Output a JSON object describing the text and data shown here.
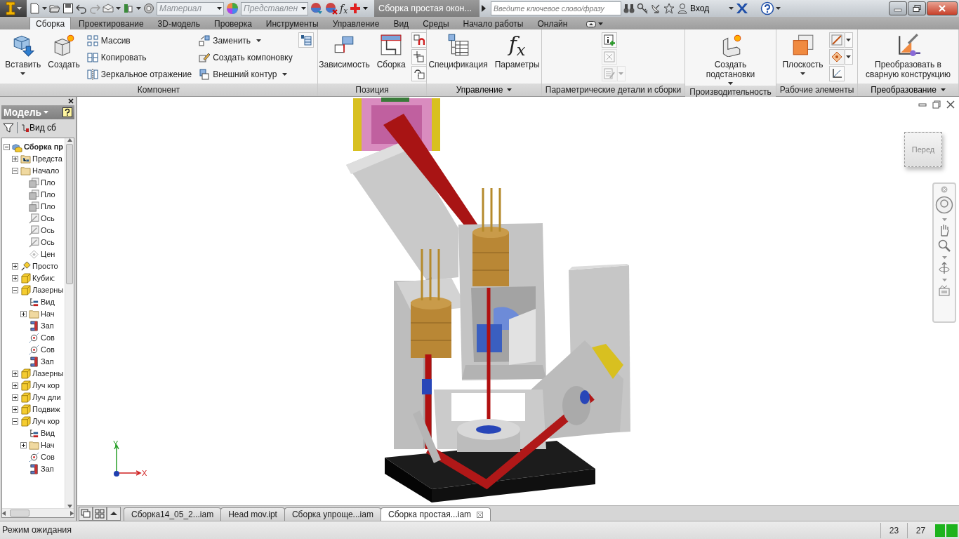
{
  "title_bar": {
    "material": "Материал",
    "appearance": "Представлен",
    "symbol": "f$_{x}$",
    "document_title": "Сборка простая окон...",
    "search": {
      "placeholder": "Введите ключевое слово/фразу"
    },
    "sign_in": "Вход"
  },
  "tabs": [
    {
      "label": "Сборка",
      "selected": true
    },
    {
      "label": "Проектирование",
      "selected": false
    },
    {
      "label": "3D-модель",
      "selected": false
    },
    {
      "label": "Проверка",
      "selected": false
    },
    {
      "label": "Инструменты",
      "selected": false
    },
    {
      "label": "Управление",
      "selected": false
    },
    {
      "label": "Вид",
      "selected": false
    },
    {
      "label": "Среды",
      "selected": false
    },
    {
      "label": "Начало работы",
      "selected": false
    },
    {
      "label": "Онлайн",
      "selected": false
    }
  ],
  "ribbon": [
    {
      "label": "Компонент",
      "menu": false,
      "groups": [
        {
          "kind": "large",
          "label": "Вставить",
          "dropdown": true
        },
        {
          "kind": "large",
          "label": "Создать",
          "dropdown": false
        },
        {
          "kind": "list",
          "items": [
            {
              "label": "Массив",
              "dropdown": false
            },
            {
              "label": "Копировать",
              "dropdown": false
            },
            {
              "label": "Зеркальное отражение",
              "dropdown": false
            }
          ]
        },
        {
          "kind": "list",
          "items": [
            {
              "label": "Заменить",
              "dropdown": true
            },
            {
              "label": "Создать компоновку",
              "dropdown": false
            },
            {
              "label": "Внешний контур",
              "dropdown": true
            }
          ]
        },
        {
          "kind": "icons",
          "items": [
            {
              "dropdown": false,
              "disabled": false
            }
          ]
        }
      ]
    },
    {
      "label": "Позиция",
      "menu": false,
      "groups": [
        {
          "kind": "large",
          "label": "Зависимость",
          "dropdown": false
        },
        {
          "kind": "large",
          "label": "Сборка",
          "dropdown": false
        },
        {
          "kind": "icons",
          "items": [
            {
              "dropdown": false,
              "disabled": false
            },
            {
              "dropdown": false,
              "disabled": false
            },
            {
              "dropdown": false,
              "disabled": false
            }
          ]
        }
      ]
    },
    {
      "label": "Управление",
      "menu": true,
      "groups": [
        {
          "kind": "large",
          "label": "Спецификация",
          "dropdown": false
        },
        {
          "kind": "large",
          "label": "Параметры",
          "symbol": "f$_{x}$",
          "dropdown": false
        }
      ]
    },
    {
      "label": "Параметрические детали и сборки",
      "menu": false,
      "groups": [
        {
          "kind": "icons",
          "items": [
            {
              "dropdown": false,
              "disabled": false
            },
            {
              "dropdown": false,
              "disabled": true
            },
            {
              "dropdown": true,
              "disabled": true
            }
          ]
        }
      ]
    },
    {
      "label": "Производительность",
      "menu": false,
      "groups": [
        {
          "kind": "large",
          "label": "Создать подстановки",
          "dropdown": true
        }
      ]
    },
    {
      "label": "Рабочие элементы",
      "menu": false,
      "groups": [
        {
          "kind": "large",
          "label": "Плоскость",
          "dropdown": true
        },
        {
          "kind": "icons",
          "items": [
            {
              "dropdown": true,
              "disabled": false
            },
            {
              "dropdown": true,
              "disabled": false
            },
            {
              "dropdown": false,
              "disabled": false
            }
          ]
        }
      ]
    },
    {
      "label": "Преобразование",
      "menu": true,
      "groups": [
        {
          "kind": "large",
          "label": "Преобразовать в сварную конструкцию",
          "dropdown": false
        }
      ]
    }
  ],
  "browser": {
    "title": "Модель",
    "view_label": "Вид сб",
    "tree": [
      {
        "label": "Сборка пр",
        "kind": "assembly",
        "expanded": true,
        "children": [
          {
            "label": "Предста",
            "kind": "representations",
            "expanded": false
          },
          {
            "label": "Начало",
            "kind": "folder",
            "expanded": true,
            "children": [
              {
                "label": "Пло",
                "kind": "plane"
              },
              {
                "label": "Пло",
                "kind": "plane"
              },
              {
                "label": "Пло",
                "kind": "plane"
              },
              {
                "label": "Ось",
                "kind": "axis"
              },
              {
                "label": "Ось",
                "kind": "axis"
              },
              {
                "label": "Ось",
                "kind": "axis"
              },
              {
                "label": "Цен",
                "kind": "point"
              }
            ]
          },
          {
            "label": "Просто",
            "kind": "pinned",
            "expanded": false
          },
          {
            "label": "Кубик:",
            "kind": "part",
            "expanded": false
          },
          {
            "label": "Лазерны",
            "kind": "part",
            "expanded": true,
            "children": [
              {
                "label": "Вид",
                "kind": "view"
              },
              {
                "label": "Нач",
                "kind": "folder",
                "expanded": false
              },
              {
                "label": "Зап",
                "kind": "joint"
              },
              {
                "label": "Сов",
                "kind": "mate"
              },
              {
                "label": "Сов",
                "kind": "mate"
              },
              {
                "label": "Зап",
                "kind": "joint"
              }
            ]
          },
          {
            "label": "Лазерны",
            "kind": "part",
            "expanded": false
          },
          {
            "label": "Луч кор",
            "kind": "part",
            "expanded": false
          },
          {
            "label": "Луч дли",
            "kind": "part",
            "expanded": false
          },
          {
            "label": "Подвиж",
            "kind": "part",
            "expanded": false
          },
          {
            "label": "Луч кор",
            "kind": "part",
            "expanded": true,
            "children": [
              {
                "label": "Вид",
                "kind": "view"
              },
              {
                "label": "Нач",
                "kind": "folder",
                "expanded": false
              },
              {
                "label": "Сов",
                "kind": "mate"
              },
              {
                "label": "Зап",
                "kind": "joint"
              }
            ]
          }
        ]
      }
    ]
  },
  "viewport": {
    "view_cube": "Перед",
    "y_label": "Y",
    "x_label": "X"
  },
  "documents": [
    {
      "label": "Сборка14_05_2...iam",
      "selected": false
    },
    {
      "label": "Head mov.ipt",
      "selected": false
    },
    {
      "label": "Сборка упроще...iam",
      "selected": false
    },
    {
      "label": "Сборка простая...iam",
      "selected": true
    }
  ],
  "status_bar": {
    "message": "Режим ожидания",
    "fields": [
      "23",
      "27"
    ]
  }
}
